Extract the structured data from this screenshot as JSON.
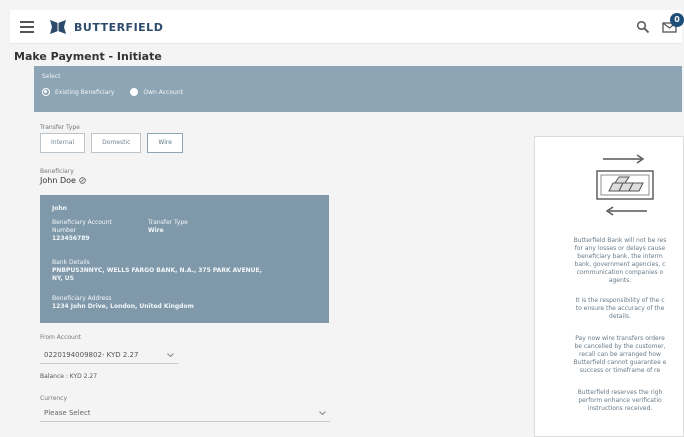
{
  "header": {
    "brand": "BUTTERFIELD",
    "notification_count": "0"
  },
  "page": {
    "title": "Make Payment - Initiate"
  },
  "select": {
    "label": "Select",
    "options": [
      "Existing Beneficiary",
      "Own Account"
    ],
    "selected": "Existing Beneficiary"
  },
  "transfer_type": {
    "label": "Transfer Type",
    "options": [
      "Internal",
      "Domestic",
      "Wire"
    ],
    "selected": "Wire"
  },
  "beneficiary": {
    "label": "Beneficiary",
    "name": "John Doe",
    "card": {
      "title": "John",
      "account_label_line1": "Beneficiary Account",
      "account_label_line2": "Number",
      "account_number": "123456789",
      "transfer_type_label": "Transfer Type",
      "transfer_type_value": "Wire",
      "bank_details_label": "Bank Details",
      "bank_details_line1": "PNBPUS3NNYC, WELLS FARGO BANK, N.A., 375 PARK AVENUE,",
      "bank_details_line2": "NY, US",
      "address_label": "Beneficiary Address",
      "address_value": "1234 John Drive, London, United Kingdom"
    }
  },
  "from_account": {
    "label": "From Account",
    "value": "0220194009802- KYD 2.27",
    "balance": "Balance : KYD 2.27"
  },
  "currency": {
    "label": "Currency",
    "placeholder": "Please Select"
  },
  "info": {
    "lines": [
      "Butterfield Bank will not be res",
      "for any losses or delays cause",
      "beneficiary bank, the interm",
      "bank, government agencies, c",
      "communication companies o",
      "agents.",
      "",
      "It is the responsibility of the c",
      "to ensure the accuracy of the",
      "details.",
      "",
      "Pay now wire transfers ordere",
      "be cancelled by the customer,",
      "recall can be arranged how",
      "Butterfield cannot guarantee e",
      "success or timeframe of re",
      "",
      "Butterfield reserves the righ",
      "perform enhance verificatio",
      "instructions received."
    ]
  },
  "colors": {
    "panel": "#8da5b5",
    "card": "#7f99ab",
    "brand": "#2c4a6b"
  },
  "icons": {
    "menu": "hamburger-icon",
    "logo": "butterfield-logo-icon",
    "search": "search-icon",
    "messages": "message-icon",
    "edit": "edit-icon",
    "transfer": "money-transfer-icon"
  }
}
